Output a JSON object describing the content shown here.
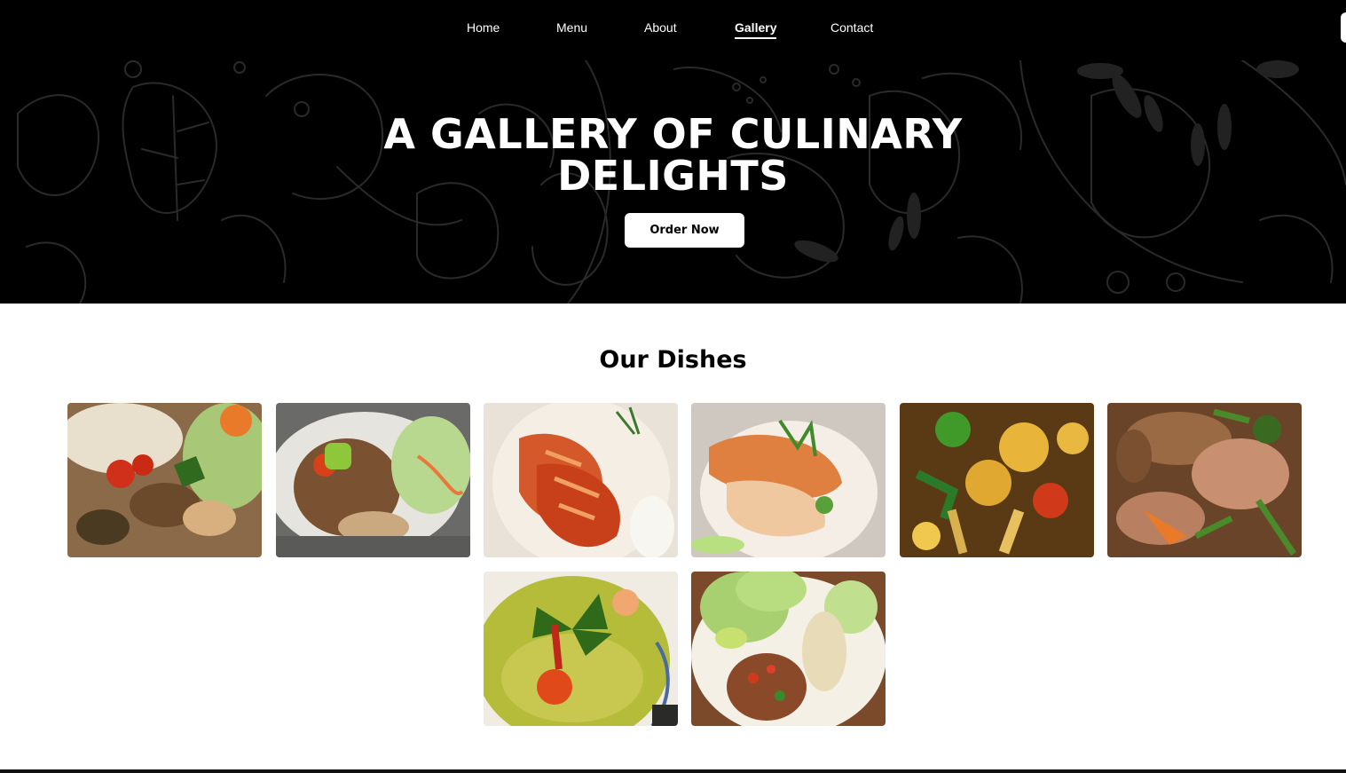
{
  "nav": {
    "items": [
      {
        "label": "Home",
        "active": false
      },
      {
        "label": "Menu",
        "active": false
      },
      {
        "label": "About",
        "active": false
      },
      {
        "label": "Gallery",
        "active": true
      },
      {
        "label": "Contact",
        "active": false
      }
    ]
  },
  "hero": {
    "title_line1": "A GALLERY OF CULINARY",
    "title_line2": "DELIGHTS",
    "button_label": "Order Now"
  },
  "dishes": {
    "heading": "Our Dishes",
    "photos": [
      {
        "name": "dish-photo-1",
        "palette": [
          "#7a5a3a",
          "#c23a1c",
          "#3d6a22",
          "#e8d9b8"
        ]
      },
      {
        "name": "dish-photo-2",
        "palette": [
          "#8a6a4a",
          "#d4451a",
          "#8fbf3a",
          "#e0e0e0"
        ]
      },
      {
        "name": "dish-photo-3",
        "palette": [
          "#d65a2a",
          "#b8321a",
          "#f0e6d8",
          "#e08a3a"
        ]
      },
      {
        "name": "dish-photo-4",
        "palette": [
          "#e08a4a",
          "#f4ece0",
          "#5aa03a",
          "#c8d0d0"
        ]
      },
      {
        "name": "dish-photo-5",
        "palette": [
          "#e8b43a",
          "#6a4a1a",
          "#2f8a2a",
          "#d03a1a"
        ]
      },
      {
        "name": "dish-photo-6",
        "palette": [
          "#7a5030",
          "#e07a3a",
          "#4a7a2a",
          "#b89070"
        ]
      },
      {
        "name": "dish-photo-7",
        "palette": [
          "#b8c040",
          "#2a5a1a",
          "#e04a1a",
          "#f0ece0"
        ]
      },
      {
        "name": "dish-photo-8",
        "palette": [
          "#8a4a2a",
          "#a8d070",
          "#e8e0c8",
          "#d03a1a"
        ]
      }
    ]
  },
  "colors": {
    "nav_bg": "#000000",
    "hero_bg": "#000000",
    "accent": "#ffffff"
  }
}
